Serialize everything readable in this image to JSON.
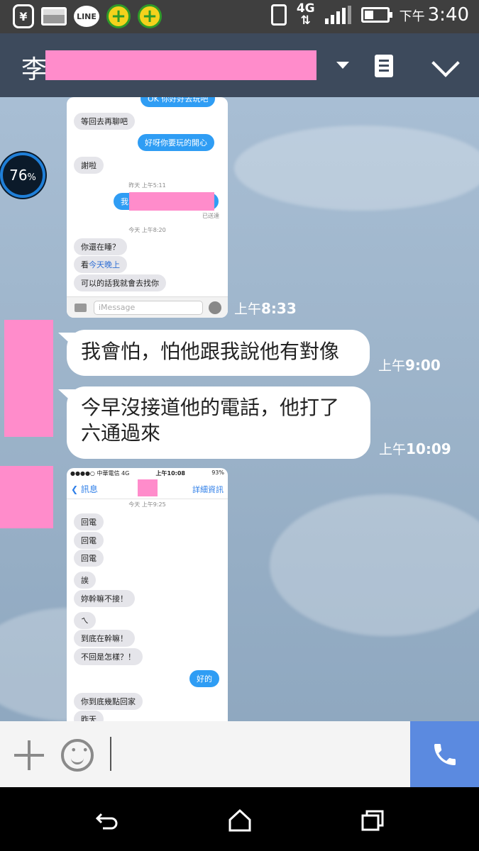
{
  "status_bar": {
    "network": "4G",
    "time_period": "下午",
    "time": "3:40",
    "line_app": "LINE",
    "battery_widget_value": "76",
    "battery_widget_unit": "%"
  },
  "header": {
    "contact_initial": "李",
    "icons": [
      "dropdown-caret-icon",
      "notes-icon",
      "chevron-down-icon"
    ]
  },
  "messages": {
    "screenshot1": {
      "top_cut_text": "OK 你好好去玩吧",
      "items": [
        {
          "dir": "in",
          "text": "等回去再聊吧"
        },
        {
          "dir": "out",
          "text": "好呀你要玩的開心"
        },
        {
          "dir": "in",
          "text": "謝啦"
        },
        {
          "dir": "ts",
          "text": "昨天 上午5:11"
        },
        {
          "dir": "out",
          "text": "我"
        },
        {
          "dir": "status",
          "text": "已送達"
        },
        {
          "dir": "ts",
          "text": "今天 上午8:20"
        },
        {
          "dir": "in",
          "text": "你還在睡？"
        },
        {
          "dir": "in_link",
          "prefix": "看",
          "link": "今天晚上"
        },
        {
          "dir": "in",
          "text": "可以的話我就會去找你"
        }
      ],
      "input_placeholder": "iMessage",
      "time_period": "上午",
      "time": "8:33"
    },
    "bubble1": {
      "text": "我會怕，怕他跟我說他有對像",
      "time_period": "上午",
      "time": "9:00"
    },
    "bubble2": {
      "line1": "今早沒接道他的電話，他打了",
      "line2": "六通過來",
      "time_period": "上午",
      "time": "10:09"
    },
    "screenshot2": {
      "status_carrier": "●●●●○ 中華電信  4G",
      "status_time": "上午10:08",
      "status_battery": "93%",
      "back_label": "訊息",
      "details_label": "詳細資訊",
      "date_label": "今天 上午9:25",
      "items": [
        {
          "dir": "in",
          "text": "回電"
        },
        {
          "dir": "in",
          "text": "回電"
        },
        {
          "dir": "in",
          "text": "回電"
        },
        {
          "dir": "in",
          "text": "誒"
        },
        {
          "dir": "in",
          "text": "妳幹嘛不接！"
        },
        {
          "dir": "in",
          "text": "ㄟ"
        },
        {
          "dir": "in",
          "text": "到底在幹嘛！"
        },
        {
          "dir": "in",
          "text": "不回是怎樣？！"
        },
        {
          "dir": "out",
          "text": "好的"
        },
        {
          "dir": "in",
          "text": "你到底幾點回家"
        },
        {
          "dir": "in",
          "text": "昨天"
        }
      ]
    }
  },
  "input_bar": {
    "icons": [
      "plus-icon",
      "emoji-icon",
      "phone-icon"
    ]
  },
  "nav_bar": {
    "icons": [
      "back-icon",
      "home-icon",
      "recents-icon"
    ]
  },
  "colors": {
    "header_bg": "#3d4a5c",
    "call_button": "#5b8ae0",
    "redaction": "#ff8ccb",
    "imessage_blue": "#2f9df4"
  }
}
